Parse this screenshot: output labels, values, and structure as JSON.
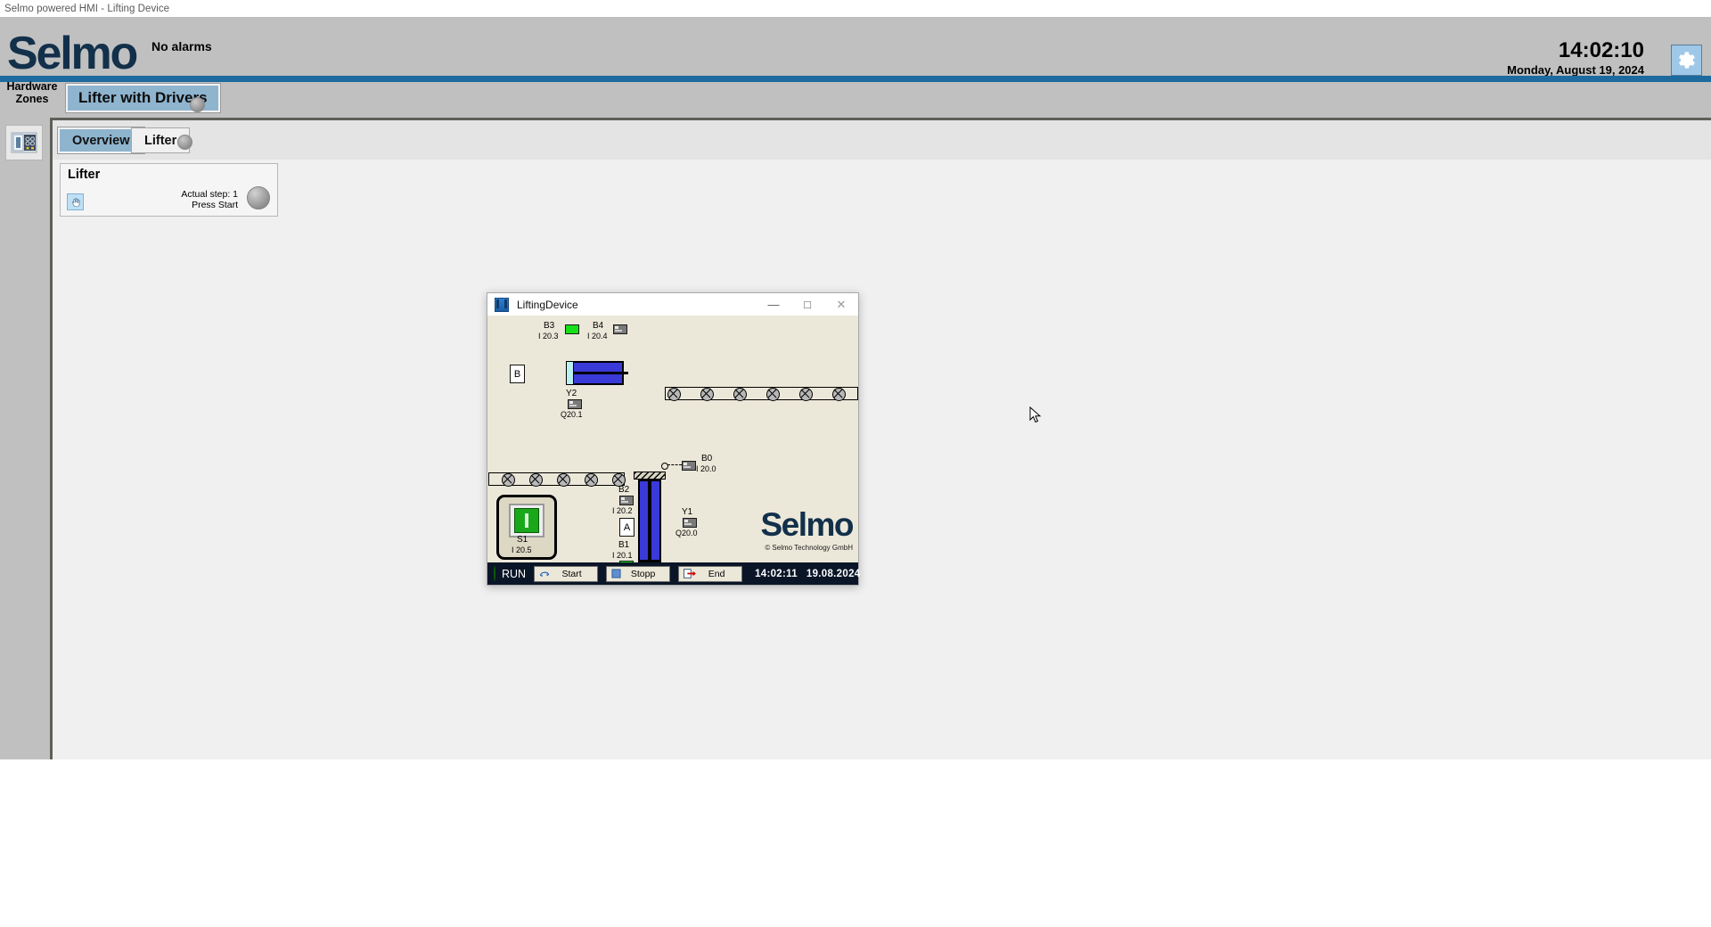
{
  "os": {
    "window_title": "Selmo powered HMI - Lifting Device"
  },
  "header": {
    "brand": "Selmo",
    "alarm_status": "No alarms",
    "time": "14:02:10",
    "date": "Monday, August 19, 2024",
    "settings_icon": "gear-icon"
  },
  "zones": {
    "label": "Hardware\nZones",
    "label_line1": "Hardware",
    "label_line2": "Zones",
    "active_zone": "Lifter with Drivers"
  },
  "rail": {
    "icon": "hardware-panel-icon"
  },
  "tabs": [
    {
      "label": "Overview",
      "active": true
    },
    {
      "label": "Lifter",
      "active": false
    }
  ],
  "lifter_card": {
    "title": "Lifter",
    "hand_icon": "hand-icon",
    "actual_step": "Actual step: 1",
    "prompt": "Press Start"
  },
  "sim_window": {
    "title": "LiftingDevice",
    "app_icon": "app-icon",
    "minimize": "—",
    "maximize": "□",
    "close": "✕",
    "brand": "Selmo",
    "copyright": "© Selmo Technology GmbH",
    "statusbar": {
      "run_label": "RUN",
      "buttons": [
        {
          "label": "Start",
          "icon": "start-icon"
        },
        {
          "label": "Stopp",
          "icon": "stop-icon"
        },
        {
          "label": "End",
          "icon": "exit-icon"
        }
      ],
      "time": "14:02:11",
      "date": "19.08.2024"
    },
    "io_signals": [
      {
        "name": "B3",
        "address": "I 20.3",
        "state": "on"
      },
      {
        "name": "B4",
        "address": "I 20.4",
        "state": "off"
      },
      {
        "name": "Y2",
        "address": "Q20.1",
        "state": "off"
      },
      {
        "name": "B0",
        "address": "I 20.0",
        "state": "off"
      },
      {
        "name": "B2",
        "address": "I 20.2",
        "state": "off"
      },
      {
        "name": "B1",
        "address": "I 20.1",
        "state": "on"
      },
      {
        "name": "Y1",
        "address": "Q20.0",
        "state": "off"
      },
      {
        "name": "S1",
        "address": "I 20.5",
        "state": "on"
      }
    ],
    "cylinder_labels": [
      "B",
      "A"
    ]
  },
  "colors": {
    "accent_blue": "#1d6a9e",
    "tab_active": "#8fb4ce",
    "brand_navy": "#12304a",
    "header_gray": "#c0c0c0",
    "sim_bg": "#ece8d9",
    "statusbar_navy": "#0a1628",
    "cylinder_blue": "#3a3ad8",
    "led_green": "#18e018"
  }
}
